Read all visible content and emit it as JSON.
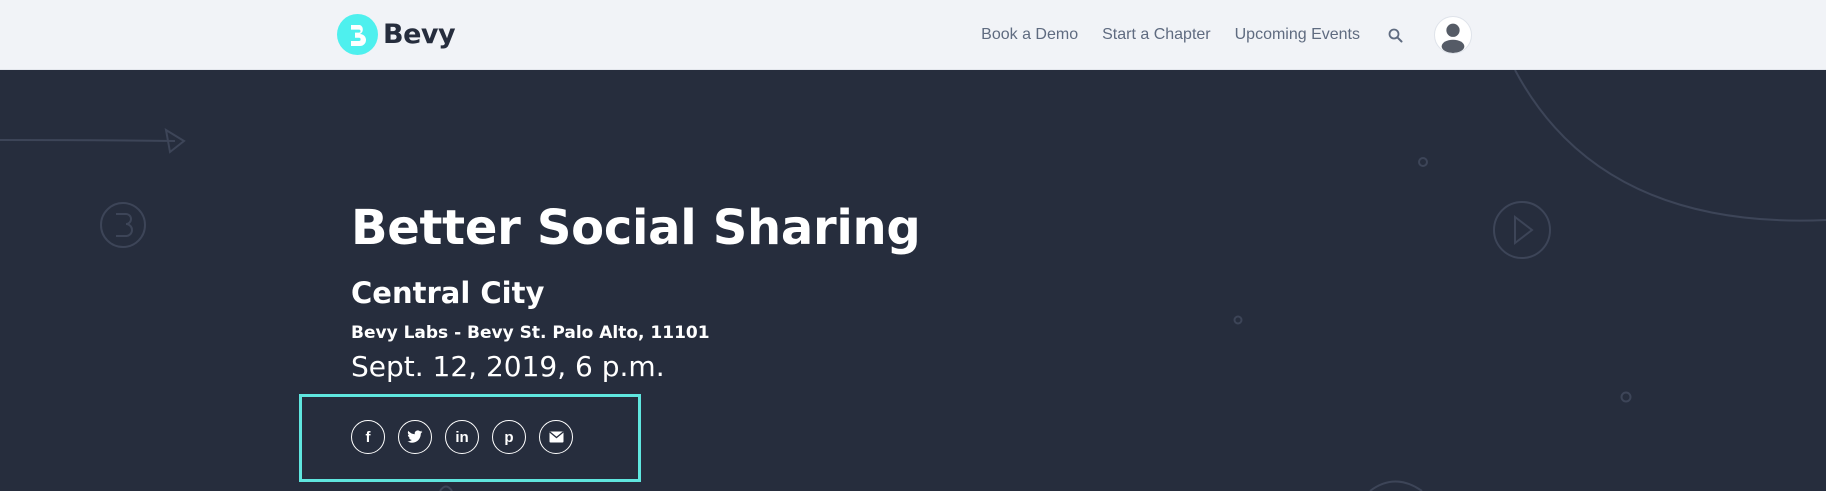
{
  "brand": {
    "name": "Bevy",
    "accent": "#4ef0ee",
    "dark": "#262d3d"
  },
  "nav": {
    "links": [
      "Book a Demo",
      "Start a Chapter",
      "Upcoming Events"
    ],
    "search_icon": "search-icon",
    "avatar_icon": "user-avatar-icon"
  },
  "event": {
    "title": "Better Social Sharing",
    "city": "Central City",
    "venue": "Bevy Labs - Bevy St. Palo Alto, 11101",
    "date": "Sept. 12, 2019, 6 p.m."
  },
  "share": {
    "highlight_color": "#5fe6df",
    "buttons": [
      {
        "icon": "facebook-icon",
        "glyph": "f"
      },
      {
        "icon": "twitter-icon"
      },
      {
        "icon": "linkedin-icon",
        "glyph": "in"
      },
      {
        "icon": "pinterest-icon",
        "glyph": "p"
      },
      {
        "icon": "email-icon"
      }
    ]
  }
}
